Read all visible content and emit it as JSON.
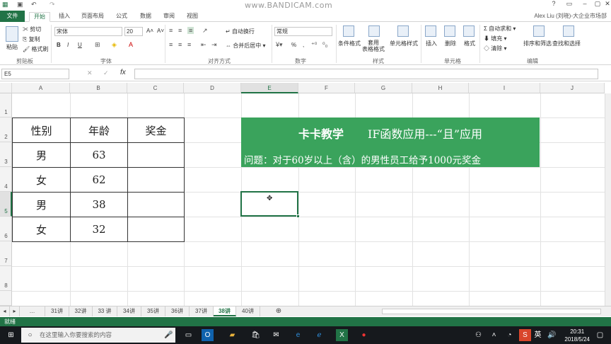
{
  "app": {
    "watermark": "www.BANDICAM.com",
    "user": "Alex Liu (刘晓)-大企业市场部"
  },
  "tabs": [
    "文件",
    "开始",
    "插入",
    "页面布局",
    "公式",
    "数据",
    "审阅",
    "视图"
  ],
  "ribbon": {
    "clipboard": {
      "cut": "剪切",
      "copy": "复制",
      "format_painter": "格式刷",
      "paste": "粘贴",
      "label": "剪贴板"
    },
    "font": {
      "name": "宋体",
      "size": "20",
      "bold": "B",
      "italic": "I",
      "underline": "U",
      "label": "字体"
    },
    "alignment": {
      "wrap": "自动换行",
      "merge": "合并后居中",
      "label": "对齐方式"
    },
    "number": {
      "format": "常规",
      "percent": "%",
      "comma": ",",
      "label": "数字"
    },
    "styles": {
      "conditional": "条件格式",
      "table": "套用\n表格格式",
      "cell_styles": "单元格样式",
      "label": "样式"
    },
    "cells": {
      "insert": "插入",
      "delete": "删除",
      "format": "格式",
      "label": "单元格"
    },
    "editing": {
      "autosum": "自动求和",
      "fill": "填充",
      "clear": "清除",
      "sort": "排序和筛选",
      "find": "查找和选择",
      "label": "编辑"
    }
  },
  "formula_bar": {
    "name_box": "E5",
    "fx": "fx",
    "value": ""
  },
  "grid": {
    "columns": [
      "A",
      "B",
      "C",
      "D",
      "E",
      "F",
      "G",
      "H",
      "I",
      "J"
    ],
    "rows": [
      "1",
      "2",
      "3",
      "4",
      "5",
      "6",
      "7",
      "8"
    ],
    "selected_column": "E",
    "selected_row": "5"
  },
  "table": {
    "headers": [
      "性别",
      "年龄",
      "奖金"
    ],
    "rows": [
      [
        "男",
        "63",
        ""
      ],
      [
        "女",
        "62",
        ""
      ],
      [
        "男",
        "38",
        ""
      ],
      [
        "女",
        "32",
        ""
      ]
    ]
  },
  "banner": {
    "brand": "卡卡教学",
    "title": "IF函数应用---“且”应用",
    "question": "问题：对于60岁以上（含）的男性员工给予1000元奖金",
    "color": "#3aa35c"
  },
  "sheets": [
    "31讲",
    "32讲",
    "33 讲",
    "34讲",
    "35讲",
    "36讲",
    "37讲",
    "38讲",
    "40讲"
  ],
  "active_sheet": "38讲",
  "status": {
    "ready": "就绪"
  },
  "taskbar": {
    "search_placeholder": "在这里输入你要搜索的内容",
    "time": "20:31",
    "date": "2018/5/24",
    "lang": "英"
  },
  "colors": {
    "accent": "#217346",
    "banner": "#3aa35c"
  }
}
